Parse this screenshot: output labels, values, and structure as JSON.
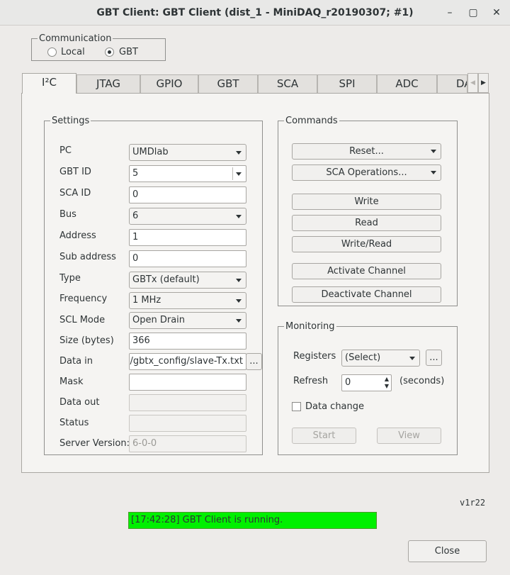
{
  "window": {
    "title": "GBT Client: GBT Client (dist_1 - MiniDAQ_r20190307; #1)",
    "minimize": "–",
    "maximize": "▢",
    "close": "✕"
  },
  "communication": {
    "legend": "Communication",
    "options": [
      {
        "label": "Local",
        "checked": false
      },
      {
        "label": "GBT",
        "checked": true
      }
    ]
  },
  "tabs": [
    "I²C",
    "JTAG",
    "GPIO",
    "GBT",
    "SCA",
    "SPI",
    "ADC",
    "DA"
  ],
  "settings": {
    "legend": "Settings",
    "pc": {
      "label": "PC",
      "value": "UMDlab"
    },
    "gbt_id": {
      "label": "GBT ID",
      "value": "5"
    },
    "sca_id": {
      "label": "SCA ID",
      "value": "0"
    },
    "bus": {
      "label": "Bus",
      "value": "6"
    },
    "address": {
      "label": "Address",
      "value": "1"
    },
    "sub_address": {
      "label": "Sub address",
      "value": "0"
    },
    "type": {
      "label": "Type",
      "value": "GBTx (default)"
    },
    "frequency": {
      "label": "Frequency",
      "value": "1 MHz"
    },
    "scl_mode": {
      "label": "SCL Mode",
      "value": "Open Drain"
    },
    "size": {
      "label": "Size (bytes)",
      "value": "366"
    },
    "data_in": {
      "label": "Data in",
      "value": "min/gbtx_config/slave-Tx.txt",
      "browse": "..."
    },
    "mask": {
      "label": "Mask",
      "value": ""
    },
    "data_out": {
      "label": "Data out",
      "value": ""
    },
    "status": {
      "label": "Status",
      "value": ""
    },
    "server_version": {
      "label": "Server Version:",
      "value": "6-0-0"
    }
  },
  "commands": {
    "legend": "Commands",
    "reset": "Reset...",
    "sca_operations": "SCA Operations...",
    "write": "Write",
    "read": "Read",
    "write_read": "Write/Read",
    "activate": "Activate Channel",
    "deactivate": "Deactivate Channel"
  },
  "monitoring": {
    "legend": "Monitoring",
    "registers_label": "Registers",
    "registers_value": "(Select)",
    "registers_browse": "...",
    "refresh_label": "Refresh",
    "refresh_value": "0",
    "refresh_unit": "(seconds)",
    "data_change_label": "Data change",
    "data_change_checked": false,
    "start": "Start",
    "view": "View"
  },
  "footer": {
    "version": "v1r22",
    "status_text": "[17:42:28] GBT Client is running.",
    "status_color": "#00f000",
    "close": "Close"
  }
}
